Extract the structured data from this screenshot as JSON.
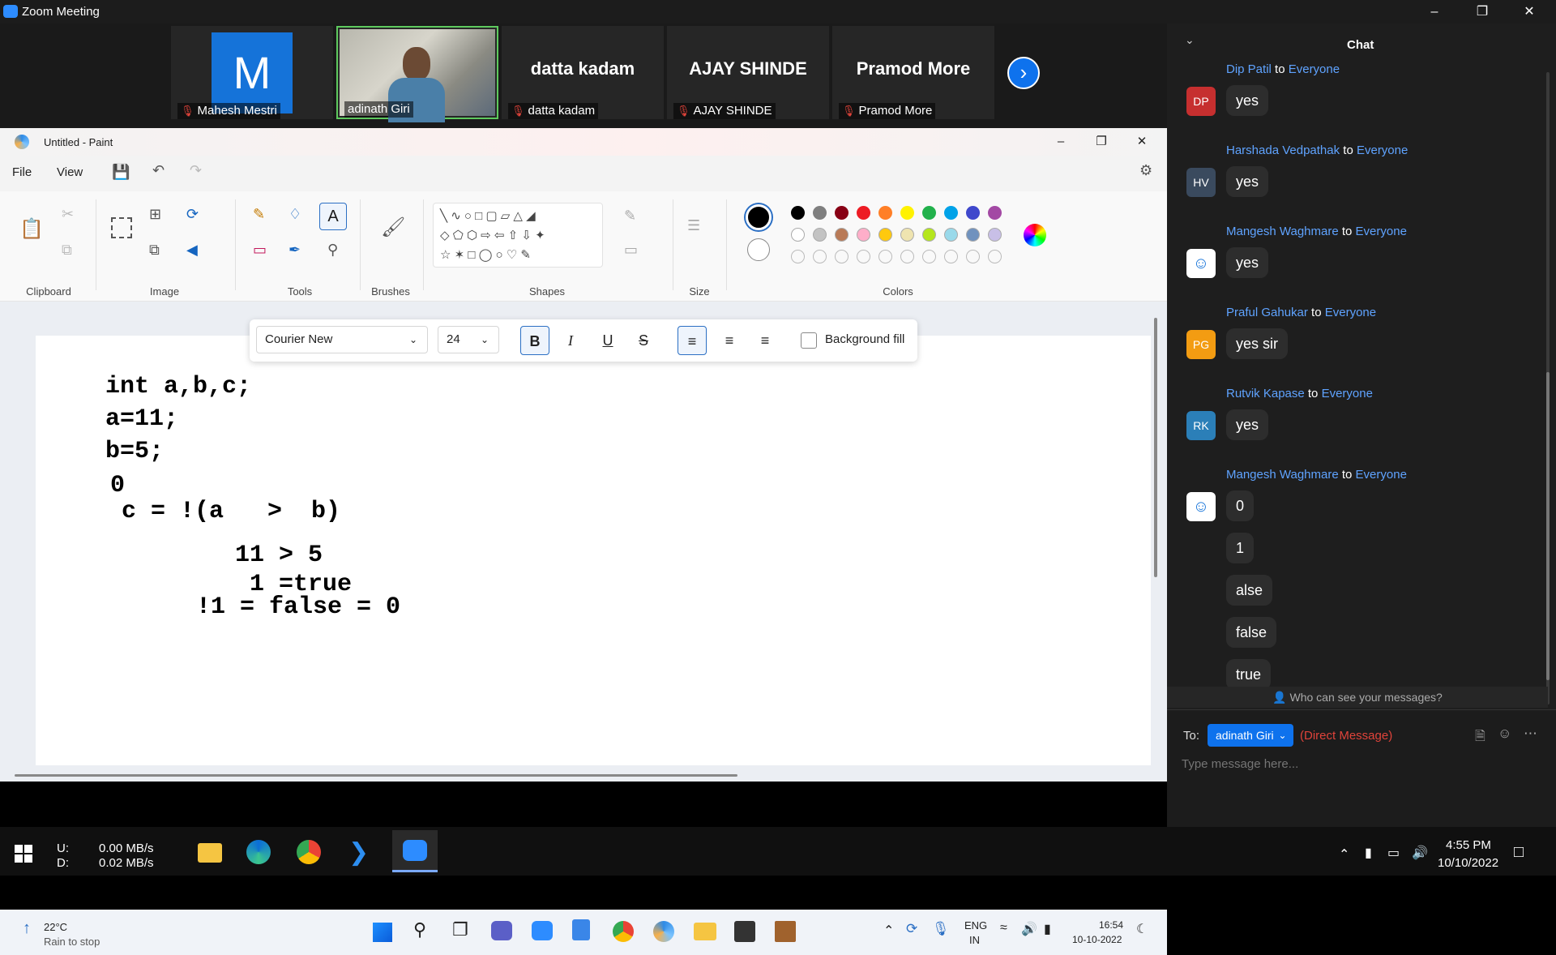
{
  "window": {
    "title": "Zoom Meeting"
  },
  "participants": [
    {
      "name": "Mahesh Mestri",
      "initial": "M"
    },
    {
      "name": "adinath Giri"
    },
    {
      "name": "datta kadam",
      "display": "datta kadam"
    },
    {
      "name": "AJAY SHINDE",
      "display": "AJAY SHINDE"
    },
    {
      "name": "Pramod More",
      "display": "Pramod More"
    }
  ],
  "paint": {
    "title": "Untitled - Paint",
    "menu": [
      "File",
      "View"
    ],
    "groups": [
      "Clipboard",
      "Image",
      "Tools",
      "Brushes",
      "Shapes",
      "Size",
      "Colors"
    ],
    "font": "Courier New",
    "size": "24",
    "bg_fill": "Background fill",
    "colors_row1": [
      "#000000",
      "#7f7f7f",
      "#880015",
      "#ed1c24",
      "#ff7f27",
      "#fff200",
      "#22b14c",
      "#00a2e8",
      "#3f48cc",
      "#a349a4"
    ],
    "colors_row2": [
      "#ffffff",
      "#c3c3c3",
      "#b97a57",
      "#ffaec9",
      "#ffc90e",
      "#efe4b0",
      "#b5e61d",
      "#99d9ea",
      "#7092be",
      "#c8bfe7"
    ],
    "code": [
      "int a,b,c;",
      "a=11;",
      "b=5;",
      "0",
      "c = !(a   >  b)",
      "11 > 5",
      "1 =true",
      "!1 = false = 0"
    ]
  },
  "taskbar2": {
    "temp": "22°C",
    "weather": "Rain to stop",
    "lang1": "ENG",
    "lang2": "IN",
    "time": "16:54",
    "date": "10-10-2022"
  },
  "chat": {
    "title": "Chat",
    "messages": [
      {
        "from": "Dip Patil",
        "to": "Everyone",
        "initials": "DP",
        "color": "#c62f2f",
        "texts": [
          "yes"
        ]
      },
      {
        "from": "Harshada Vedpathak",
        "to": "Everyone",
        "initials": "HV",
        "color": "#3a4a5e",
        "texts": [
          "yes"
        ]
      },
      {
        "from": "Mangesh Waghmare",
        "to": "Everyone",
        "initials": "",
        "color": "#ffffff",
        "texts": [
          "yes"
        ]
      },
      {
        "from": "Praful Gahukar",
        "to": "Everyone",
        "initials": "PG",
        "color": "#f39c12",
        "texts": [
          "yes sir"
        ]
      },
      {
        "from": "Rutvik Kapase",
        "to": "Everyone",
        "initials": "RK",
        "color": "#2b7fb8",
        "texts": [
          "yes"
        ]
      },
      {
        "from": "Mangesh Waghmare",
        "to": "Everyone",
        "initials": "",
        "color": "#ffffff",
        "texts": [
          "0",
          "1",
          "alse",
          "false",
          "true"
        ]
      }
    ],
    "who": "Who can see your messages?",
    "to_label": "To:",
    "recipient": "adinath Giri",
    "direct": "(Direct Message)",
    "placeholder": "Type message here..."
  },
  "wintask": {
    "u": "U:",
    "d": "D:",
    "up": "0.00 MB/s",
    "down": "0.02 MB/s",
    "time": "4:55 PM",
    "date": "10/10/2022"
  }
}
